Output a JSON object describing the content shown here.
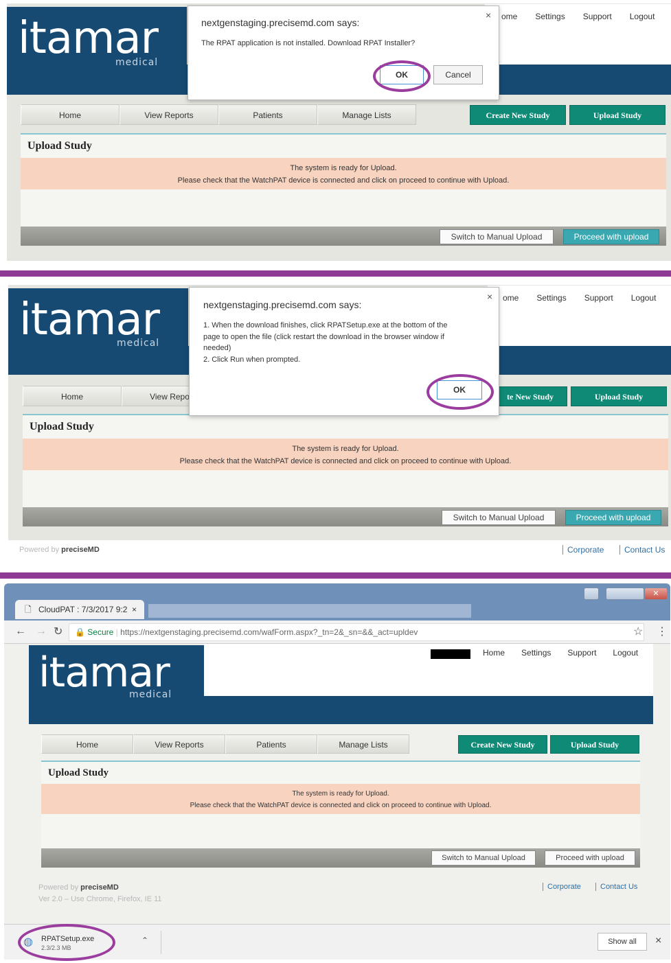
{
  "top_nav": {
    "home": "Home",
    "settings": "Settings",
    "support": "Support",
    "logout": "Logout"
  },
  "logo": {
    "word": "itamar",
    "sub": "medical"
  },
  "nav_tabs": [
    "Home",
    "View Reports",
    "Patients",
    "Manage Lists"
  ],
  "panel_2_tabs": [
    "Home",
    "View Repor"
  ],
  "action_buttons": {
    "create": "Create New Study",
    "upload": "Upload Study"
  },
  "create_partial": "te New Study",
  "panel": {
    "title": "Upload Study",
    "message_line1": "The system is ready for Upload.",
    "message_line2": "Please check that the WatchPAT device is connected and click on proceed to continue with Upload.",
    "switch_button": "Switch to Manual Upload",
    "proceed_button": "Proceed with upload"
  },
  "home_partial": "ome",
  "dialog1": {
    "title": "nextgenstaging.precisemd.com says:",
    "text": "The RPAT application is not installed. Download RPAT Installer?",
    "ok": "OK",
    "cancel": "Cancel",
    "close": "×"
  },
  "dialog2": {
    "title": "nextgenstaging.precisemd.com says:",
    "line1": "1. When the download finishes, click RPATSetup.exe at the bottom of the",
    "line2": "page to open the file (click restart the download in the browser window if",
    "line3": "needed)",
    "line4": "2. Click Run when prompted.",
    "ok": "OK",
    "close": "×"
  },
  "footer": {
    "powered_by": "Powered by",
    "brand": "preciseMD",
    "corporate": "Corporate",
    "contact": "Contact Us",
    "version": "Ver 2.0 – Use Chrome, Firefox, IE 11"
  },
  "browser": {
    "tab_title": "CloudPAT : 7/3/2017 9:2",
    "tab_close": "×",
    "secure": "Secure",
    "url": "https://nextgenstaging.precisemd.com/wafForm.aspx?_tn=2&_sn=&&_act=upldev",
    "download_file": "RPATSetup.exe",
    "download_size": "2.3/2.3 MB",
    "show_all": "Show all",
    "close_x": "×"
  },
  "colors": {
    "brand_blue": "#174a73",
    "green_button": "#0e8a76",
    "teal_button": "#3aa8b0",
    "message_bg": "#f8d4c0",
    "highlight_ring": "#9b3d9e",
    "divider": "#8e3a95"
  },
  "icons": [
    "close-icon",
    "back-arrow-icon",
    "forward-arrow-icon",
    "reload-icon",
    "lock-icon",
    "star-icon",
    "menu-dots-icon",
    "document-icon",
    "chevron-up-icon",
    "file-icon"
  ]
}
